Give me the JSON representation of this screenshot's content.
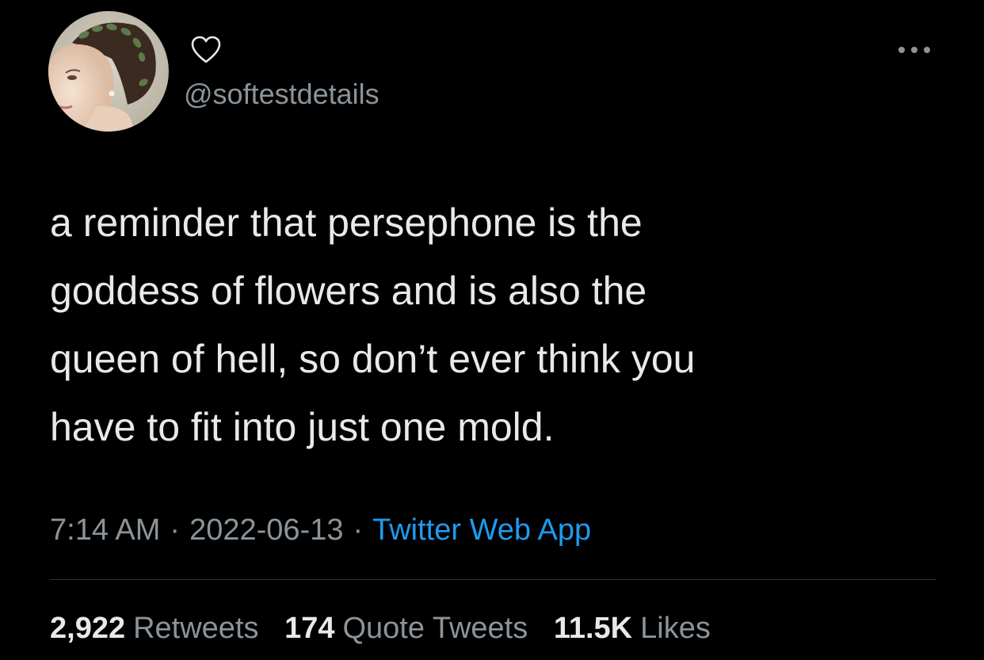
{
  "user": {
    "display_name_icon": "heart-outline-icon",
    "handle": "@softestdetails",
    "avatar": "avatar-painting-woman-with-ivy-wreath"
  },
  "header": {
    "more_icon": "more-horizontal-icon"
  },
  "tweet": {
    "lines": [
      "a reminder that persephone is the",
      "goddess of flowers and is also the",
      "queen of hell, so don’t ever think you",
      "have to fit into just one mold."
    ]
  },
  "meta": {
    "time": "7:14 AM",
    "separator": "·",
    "date": "2022-06-13",
    "source": "Twitter Web App"
  },
  "stats": {
    "retweets_count": "2,922",
    "retweets_label": "Retweets",
    "quotes_count": "174",
    "quotes_label": "Quote Tweets",
    "likes_count": "11.5K",
    "likes_label": "Likes"
  },
  "colors": {
    "background": "#000000",
    "primary_text": "#e7e9ea",
    "secondary_text": "#8b949a",
    "link": "#1d9bf0",
    "divider": "#2f3336"
  }
}
